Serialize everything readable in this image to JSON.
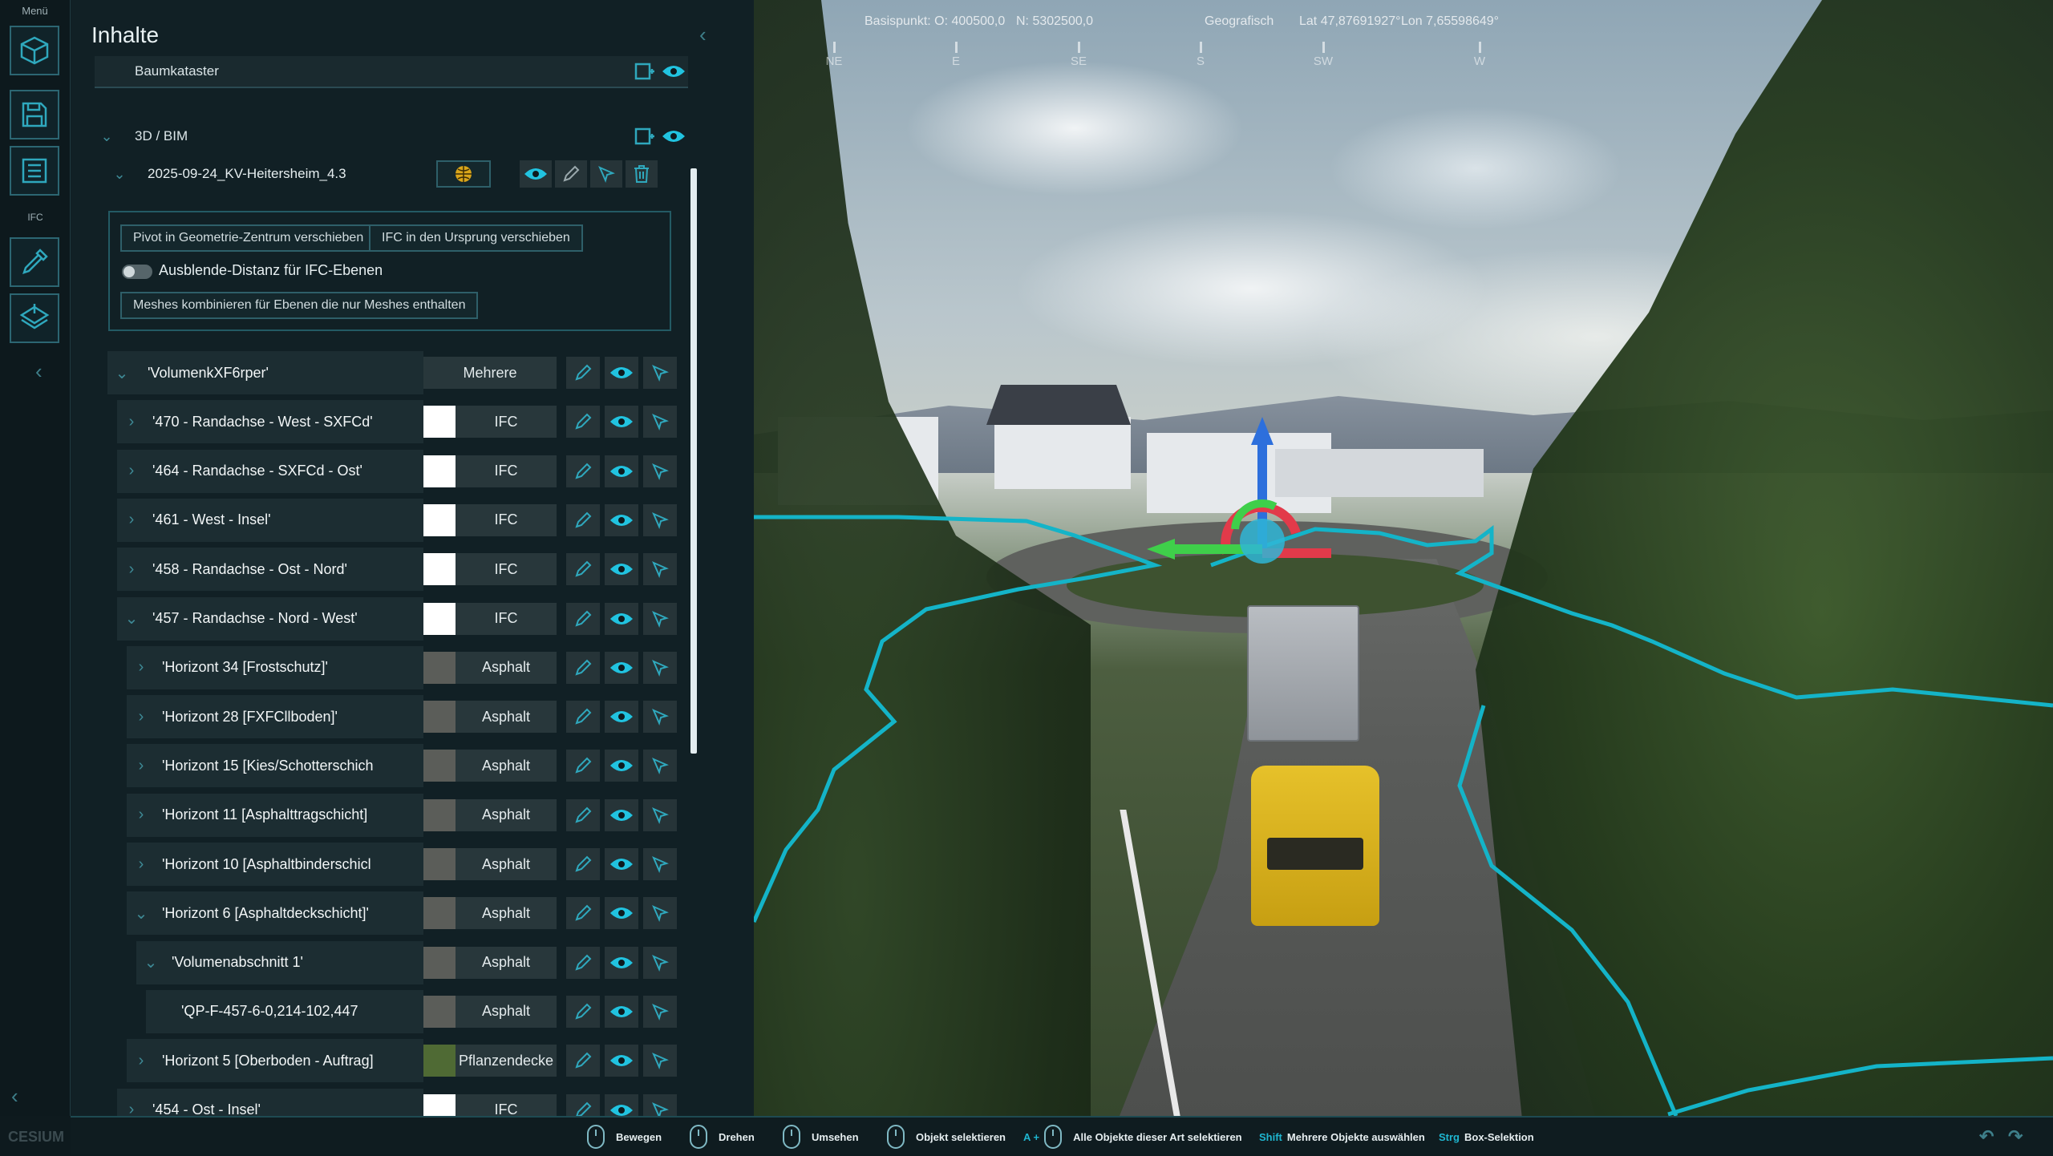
{
  "menu": {
    "title": "Menü",
    "ifc_label": "IFC"
  },
  "panel": {
    "title": "Inhalte",
    "baumkataster": "Baumkataster",
    "group_3d": "3D / BIM",
    "model_name": "2025-09-24_KV-Heitersheim_4.3",
    "options": {
      "pivot": "Pivot in Geometrie-Zentrum verschieben",
      "origin": "IFC in den Ursprung verschieben",
      "distance": "Ausblende-Distanz für IFC-Ebenen",
      "meshes": "Meshes kombinieren für Ebenen die nur Meshes enthalten"
    },
    "tree": [
      {
        "label": "'VolumenkXF6rper'",
        "material": "Mehrere",
        "swatch": "",
        "arrow": "v"
      },
      {
        "label": "'470 - Randachse - West - SXFCd'",
        "material": "IFC",
        "swatch": "#ffffff",
        "arrow": ">"
      },
      {
        "label": "'464 - Randachse - SXFCd - Ost'",
        "material": "IFC",
        "swatch": "#ffffff",
        "arrow": ">"
      },
      {
        "label": "'461 - West - Insel'",
        "material": "IFC",
        "swatch": "#ffffff",
        "arrow": ">"
      },
      {
        "label": "'458 - Randachse - Ost - Nord'",
        "material": "IFC",
        "swatch": "#ffffff",
        "arrow": ">"
      },
      {
        "label": "'457 - Randachse - Nord - West'",
        "material": "IFC",
        "swatch": "#ffffff",
        "arrow": "v"
      },
      {
        "label": "'Horizont 34 [Frostschutz]'",
        "material": "Asphalt",
        "swatch": "#5b5d59",
        "arrow": ">"
      },
      {
        "label": "'Horizont 28 [FXFCllboden]'",
        "material": "Asphalt",
        "swatch": "#5b5d59",
        "arrow": ">"
      },
      {
        "label": "'Horizont 15 [Kies/Schotterschich",
        "material": "Asphalt",
        "swatch": "#5b5d59",
        "arrow": ">"
      },
      {
        "label": "'Horizont 11 [Asphalttragschicht]",
        "material": "Asphalt",
        "swatch": "#5b5d59",
        "arrow": ">"
      },
      {
        "label": "'Horizont 10 [Asphaltbinderschicl",
        "material": "Asphalt",
        "swatch": "#5b5d59",
        "arrow": ">"
      },
      {
        "label": "'Horizont 6 [Asphaltdeckschicht]'",
        "material": "Asphalt",
        "swatch": "#5b5d59",
        "arrow": "v"
      },
      {
        "label": "'Volumenabschnitt 1'",
        "material": "Asphalt",
        "swatch": "#5b5d59",
        "arrow": "v"
      },
      {
        "label": "'QP-F-457-6-0,214-102,447",
        "material": "Asphalt",
        "swatch": "#5b5d59",
        "arrow": ""
      },
      {
        "label": "'Horizont 5 [Oberboden - Auftrag]",
        "material": "Pflanzendecke",
        "swatch": "#4f6a34",
        "arrow": ">"
      },
      {
        "label": "'454 - Ost - Insel'",
        "material": "IFC",
        "swatch": "#ffffff",
        "arrow": ">"
      }
    ]
  },
  "viewport": {
    "basispunkt": "Basispunkt: O: 400500,0",
    "north": "N: 5302500,0",
    "geo_label": "Geografisch",
    "lat": "Lat  47,87691927°",
    "lon": "Lon  7,65598649°",
    "compass": [
      "NE",
      "E",
      "SE",
      "S",
      "SW",
      "W"
    ]
  },
  "bottombar": {
    "move": "Bewegen",
    "rotate": "Drehen",
    "look": "Umsehen",
    "select": "Objekt selektieren",
    "select_all_key": "A +",
    "select_all": "Alle Objekte dieser Art selektieren",
    "shift_key": "Shift",
    "shift_label": "Mehrere Objekte auswählen",
    "strg_key": "Strg",
    "strg_label": "Box-Selektion"
  },
  "brand": "CESIUM",
  "colors": {
    "accent": "#1fb6d0",
    "eye": "#21c3e0",
    "outline": "#14b4c8"
  }
}
